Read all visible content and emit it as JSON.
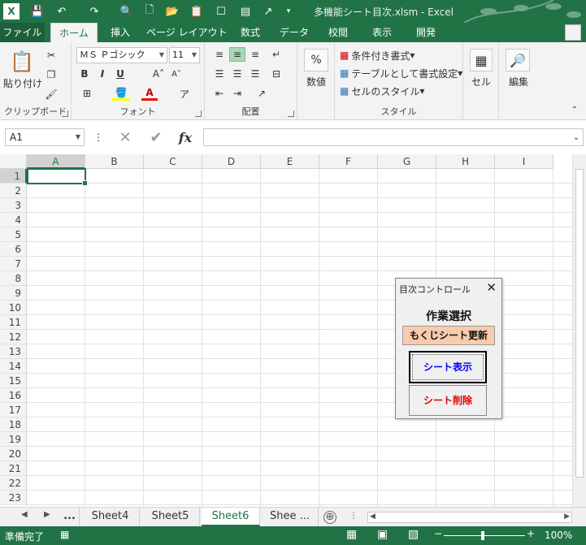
{
  "app": {
    "title": "多機能シート目次.xlsm - Excel",
    "colors": {
      "accent": "#217346",
      "ribbon_bg": "#f3f3f3",
      "refresh_button": "#f8cbad",
      "show_text": "#0000ff",
      "delete_text": "#e00000"
    }
  },
  "qat": {
    "icons": [
      "excel-icon",
      "save-icon",
      "undo-icon",
      "redo-icon",
      "print-preview-icon",
      "new-file-icon",
      "open-folder-icon",
      "paste-special-icon",
      "form-icon",
      "export-icon",
      "qat-dropdown-icon"
    ]
  },
  "tabs": {
    "file": "ファイル",
    "home": "ホーム",
    "insert": "挿入",
    "page_layout": "ページ レイアウト",
    "formulas": "数式",
    "data": "データ",
    "review": "校閲",
    "view": "表示",
    "developer": "開発"
  },
  "ribbon": {
    "clipboard": {
      "label": "クリップボード",
      "paste": "貼り付け"
    },
    "font": {
      "label": "フォント",
      "font_name": "ＭＳ Ｐゴシック",
      "font_size": "11",
      "bold": "B",
      "italic": "I",
      "underline": "U"
    },
    "alignment": {
      "label": "配置"
    },
    "number": {
      "label": "数値",
      "percent": "%"
    },
    "styles": {
      "label": "スタイル",
      "conditional": "条件付き書式",
      "as_table": "テーブルとして書式設定",
      "cell_styles": "セルのスタイル"
    },
    "cells": {
      "label": "セル"
    },
    "editing": {
      "label": "編集"
    }
  },
  "formula_bar": {
    "name_box": "A1",
    "fx": "fx",
    "value": ""
  },
  "grid": {
    "columns": [
      "A",
      "B",
      "C",
      "D",
      "E",
      "F",
      "G",
      "H",
      "I"
    ],
    "rows": [
      "1",
      "2",
      "3",
      "4",
      "5",
      "6",
      "7",
      "8",
      "9",
      "10",
      "11",
      "12",
      "13",
      "14",
      "15",
      "16",
      "17",
      "18",
      "19",
      "20",
      "21",
      "22",
      "23"
    ],
    "selected_cell": "A1"
  },
  "sheets": {
    "more_left": "...",
    "tabs": [
      "Sheet4",
      "Sheet5",
      "Sheet6",
      "Shee ..."
    ],
    "active": "Sheet6",
    "add": "⊕"
  },
  "status": {
    "ready": "準備完了",
    "zoom": "100%"
  },
  "dialog": {
    "title": "目次コントロール",
    "close": "✕",
    "heading": "作業選択",
    "refresh": "もくじシート更新",
    "show": "シート表示",
    "delete": "シート削除"
  }
}
